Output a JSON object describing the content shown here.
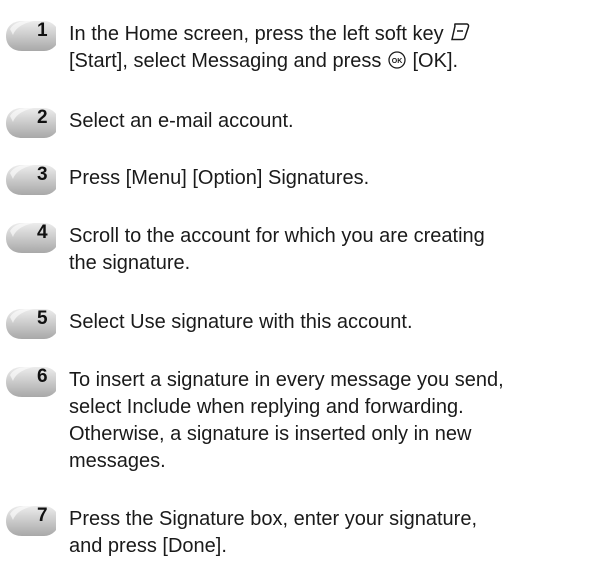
{
  "steps": [
    {
      "number": "1",
      "lines": [
        [
          "In the Home screen, press the left soft key ",
          "left-soft-key-icon",
          ""
        ],
        [
          "[Start], select Messaging and press ",
          "ok-key-icon",
          " [OK]."
        ]
      ]
    },
    {
      "number": "2",
      "lines": [
        "Select an e-mail account."
      ]
    },
    {
      "number": "3",
      "lines": [
        "Press [Menu] [Option] Signatures."
      ]
    },
    {
      "number": "4",
      "lines": [
        "Scroll to the account for which you are creating",
        "the signature."
      ]
    },
    {
      "number": "5",
      "lines": [
        "Select Use signature with this account."
      ]
    },
    {
      "number": "6",
      "lines": [
        "To insert a signature in every message you send,",
        "select Include when replying and forwarding.",
        "Otherwise, a signature is inserted only in new",
        "messages."
      ]
    },
    {
      "number": "7",
      "lines": [
        "Press the Signature box, enter your signature,",
        "and press [Done]."
      ]
    }
  ],
  "colors": {
    "text": "#1a1a1a",
    "badge_light": "#d9d9d9",
    "badge_dark": "#9a9a9a"
  }
}
